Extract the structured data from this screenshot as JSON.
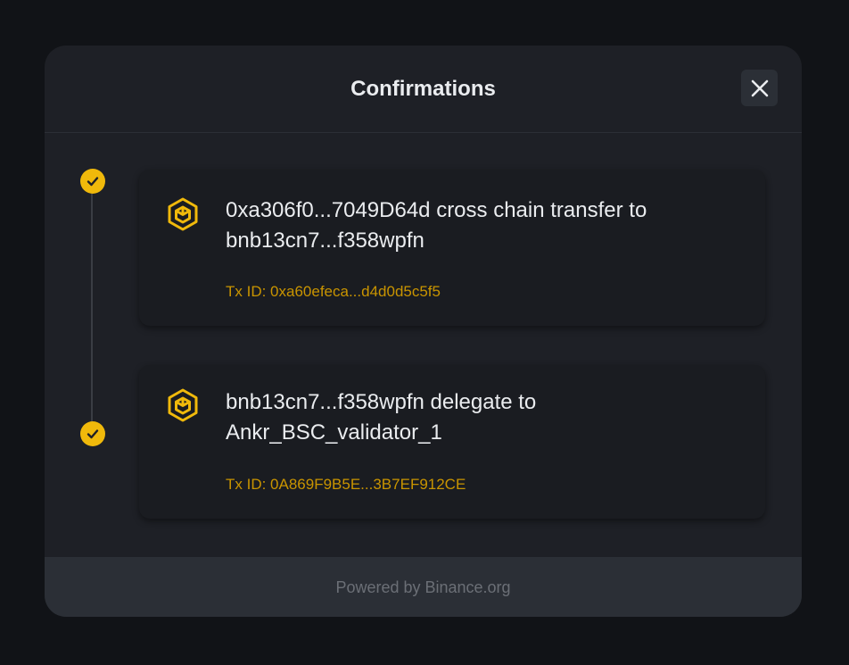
{
  "modal": {
    "title": "Confirmations",
    "close_icon": "close-icon"
  },
  "confirmations": [
    {
      "status": "confirmed",
      "icon": "bnb-chain-icon",
      "title": "0xa306f0...7049D64d cross chain transfer to bnb13cn7...f358wpfn",
      "tx_id": "Tx ID: 0xa60efeca...d4d0d5c5f5"
    },
    {
      "status": "confirmed",
      "icon": "bnb-chain-icon",
      "title": "bnb13cn7...f358wpfn delegate to Ankr_BSC_validator_1",
      "tx_id": "Tx ID: 0A869F9B5E...3B7EF912CE"
    }
  ],
  "footer": {
    "text": "Powered by Binance.org"
  },
  "colors": {
    "accent": "#F0B90B",
    "tx_link": "#C99400",
    "modal_bg": "#1E2026",
    "card_bg": "#1A1C21",
    "footer_bg": "#2B2F36"
  }
}
